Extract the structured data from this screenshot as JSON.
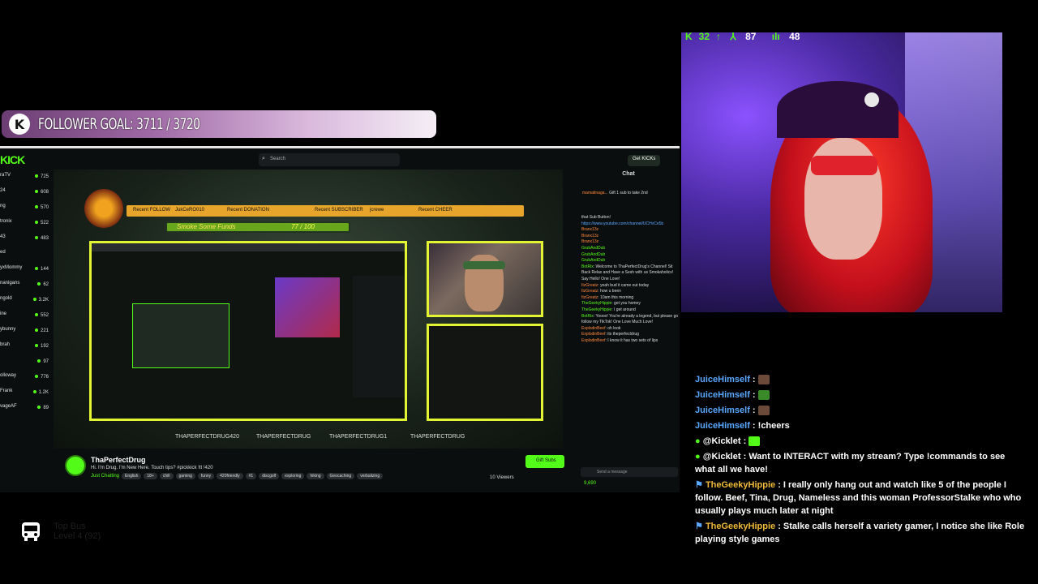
{
  "goal": {
    "logo": "K",
    "text": "FOLLOWER GOAL: 3711 / 3720"
  },
  "browser": {
    "logo": "KICK",
    "search_placeholder": "Search",
    "get_kicks": "Get KICKs",
    "sidebar": [
      {
        "name": "raTV",
        "count": "725"
      },
      {
        "name": "24",
        "count": "608"
      },
      {
        "name": "ng",
        "count": "570"
      },
      {
        "name": "tronix",
        "count": "522"
      },
      {
        "name": "43",
        "count": "483"
      },
      {
        "name": "ed",
        "count": ""
      },
      {
        "name": "yxMommy",
        "count": "144"
      },
      {
        "name": "nanigans",
        "count": "62"
      },
      {
        "name": "ngold",
        "count": "3.2K"
      },
      {
        "name": "ine",
        "count": "552"
      },
      {
        "name": "ybunny",
        "count": "221"
      },
      {
        "name": "brah",
        "count": "192"
      },
      {
        "name": "",
        "count": "97"
      },
      {
        "name": "olloway",
        "count": "776"
      },
      {
        "name": "Frank",
        "count": "1.2K"
      },
      {
        "name": "vageAF",
        "count": "89"
      }
    ],
    "stream": {
      "banner": [
        "Recent FOLLOW",
        "JukCeRO010",
        "Recent DONATION",
        "Recent SUBSCRIBER",
        "jcrewe",
        "Recent CHEER"
      ],
      "smoke_label": "Smoke Some Funds",
      "smoke_value": "77 / 100",
      "socials": [
        "THAPERFECTDRUG420",
        "THAPERFECTDRUG",
        "THAPERFECTDRUG1",
        "THAPERFECTDRUG"
      ]
    },
    "channel": {
      "name": "ThaPerfectDrug",
      "title": "Hi. I'm Drug. I'm New Here. Touch tips? #pickkick !tt !420",
      "category": "Just Chatting",
      "tags": [
        "English",
        "18+",
        "chill",
        "gaming",
        "funny",
        "420friendly",
        "#1",
        "discgolf",
        "exploring",
        "hiking",
        "Geocaching",
        "verbalizing"
      ],
      "gift_subs": "Gift Subs",
      "viewers": "10 Viewers"
    },
    "chat": {
      "header": "Chat",
      "pinned_user": "mamatinaga...",
      "pinned_note": "Gift 1 sub to take 2nd",
      "lines": [
        {
          "user": "",
          "text": "that Sub Button!"
        },
        {
          "user": "",
          "text": "https://www.youtube.com/channel/UCHvCe5b"
        },
        {
          "user": "Branx13z",
          "text": ""
        },
        {
          "user": "Branx13z",
          "text": ""
        },
        {
          "user": "Branx13z",
          "text": ""
        },
        {
          "user": "GrubAndDub",
          "text": ""
        },
        {
          "user": "GrubAndDub",
          "text": ""
        },
        {
          "user": "GrubAndDub",
          "text": ""
        },
        {
          "user": "BotRix",
          "text": "Welcome to ThaPerfectDrug's Channel! Sit Back Relax and Have a Sesh with us Smokaholics! Say Hello! One Love!"
        },
        {
          "user": "ItzGreatz",
          "text": "yeah bud it came out today"
        },
        {
          "user": "ItzGreatz",
          "text": "how u been"
        },
        {
          "user": "ItzGreatz",
          "text": "10am this morning"
        },
        {
          "user": "TheGeekyHippie",
          "text": "got you homey"
        },
        {
          "user": "TheGeekyHippie",
          "text": "I get around"
        },
        {
          "user": "BotRix",
          "text": "Yoooo! You're already a legend, but please go follow my TikTok! One Love Much Love!"
        },
        {
          "user": "ExplodinBeef",
          "text": "oh look"
        },
        {
          "user": "ExplodinBeef",
          "text": "its theperfectdrug"
        },
        {
          "user": "ExplodinBeef",
          "text": "I know it has two sets of lips"
        }
      ],
      "send_placeholder": "Send a message",
      "points": "9,690"
    }
  },
  "topbus": {
    "title": "Top Bus",
    "level": "Level 4",
    "count": "(92)"
  },
  "stats": {
    "a": "32",
    "b": "87",
    "c": "48"
  },
  "overlay_chat": [
    {
      "user": "JuiceHimself",
      "text": "",
      "style": "blue"
    },
    {
      "user": "JuiceHimself",
      "text": "",
      "style": "blue"
    },
    {
      "user": "JuiceHimself",
      "text": "",
      "style": "blue"
    },
    {
      "user": "JuiceHimself",
      "text": "!cheers",
      "style": "blue"
    },
    {
      "user": "@Kicklet",
      "text": "",
      "style": "white"
    },
    {
      "user": "@Kicklet",
      "text": "Want to INTERACT with my stream? Type !commands to see what all we have!",
      "style": "white"
    },
    {
      "user": "TheGeekyHippie",
      "text": "I really only hang out and watch like 5 of the people I follow. Beef, Tina, Drug, Nameless and this woman ProfessorStalke who who usually plays much later at night",
      "style": "gold"
    },
    {
      "user": "TheGeekyHippie",
      "text": "Stalke calls herself a variety gamer, I notice she like Role playing style games",
      "style": "gold"
    }
  ]
}
